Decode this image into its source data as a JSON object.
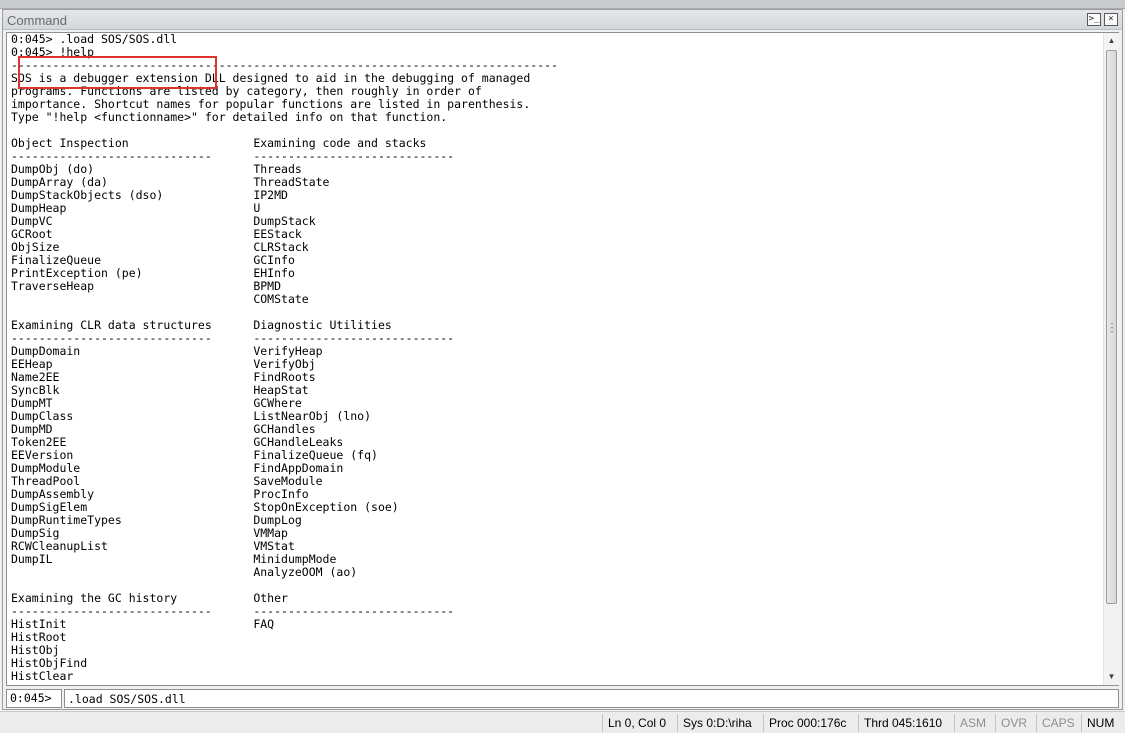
{
  "window": {
    "title": "Command",
    "prompt_button_glyph": ">_",
    "close_button_glyph": "×"
  },
  "output": {
    "lines": [
      "0:045> .load SOS/SOS.dll",
      "0:045> !help",
      "-------------------------------------------------------------------------------",
      "SOS is a debugger extension DLL designed to aid in the debugging of managed",
      "programs. Functions are listed by category, then roughly in order of",
      "importance. Shortcut names for popular functions are listed in parenthesis.",
      "Type \"!help <functionname>\" for detailed info on that function.",
      "",
      "Object Inspection                  Examining code and stacks",
      "-----------------------------      -----------------------------",
      "DumpObj (do)                       Threads",
      "DumpArray (da)                     ThreadState",
      "DumpStackObjects (dso)             IP2MD",
      "DumpHeap                           U",
      "DumpVC                             DumpStack",
      "GCRoot                             EEStack",
      "ObjSize                            CLRStack",
      "FinalizeQueue                      GCInfo",
      "PrintException (pe)                EHInfo",
      "TraverseHeap                       BPMD",
      "                                   COMState",
      "",
      "Examining CLR data structures      Diagnostic Utilities",
      "-----------------------------      -----------------------------",
      "DumpDomain                         VerifyHeap",
      "EEHeap                             VerifyObj",
      "Name2EE                            FindRoots",
      "SyncBlk                            HeapStat",
      "DumpMT                             GCWhere",
      "DumpClass                          ListNearObj (lno)",
      "DumpMD                             GCHandles",
      "Token2EE                           GCHandleLeaks",
      "EEVersion                          FinalizeQueue (fq)",
      "DumpModule                         FindAppDomain",
      "ThreadPool                         SaveModule",
      "DumpAssembly                       ProcInfo",
      "DumpSigElem                        StopOnException (soe)",
      "DumpRuntimeTypes                   DumpLog",
      "DumpSig                            VMMap",
      "RCWCleanupList                     VMStat",
      "DumpIL                             MinidumpMode",
      "                                   AnalyzeOOM (ao)",
      "",
      "Examining the GC history           Other",
      "-----------------------------      -----------------------------",
      "HistInit                           FAQ",
      "HistRoot",
      "HistObj",
      "HistObjFind",
      "HistClear"
    ]
  },
  "scrollbar": {
    "up_glyph": "▲",
    "down_glyph": "▼"
  },
  "command": {
    "prompt": "0:045>",
    "value": ".load SOS/SOS.dll"
  },
  "status": {
    "position": "Ln 0, Col 0",
    "sys": "Sys 0:D:\\riha",
    "proc": "Proc 000:176c",
    "thread": "Thrd 045:1610",
    "asm": "ASM",
    "ovr": "OVR",
    "caps": "CAPS",
    "num": "NUM"
  },
  "colors": {
    "highlight_box": "#e0322e",
    "dim_indicator": "#8e8e8e"
  }
}
